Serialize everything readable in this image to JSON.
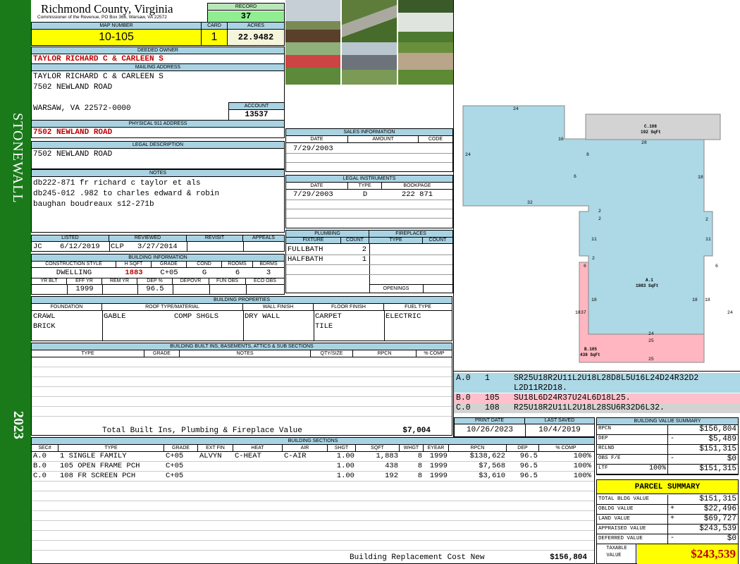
{
  "sidebar": {
    "district": "STONEWALL",
    "year": "2023"
  },
  "header": {
    "county": "Richmond County, Virginia",
    "address_line": "Commissioner of the Revenue, PO Box 366, Warsaw, VA 22572",
    "record_label": "RECORD",
    "record": "37",
    "map_label": "MAP NUMBER",
    "map_number": "10-105",
    "card_label": "CARD",
    "card": "1",
    "acres_label": "ACRES",
    "acres": "22.9482"
  },
  "owner": {
    "deeded_label": "DEEDED OWNER",
    "deeded": "TAYLOR RICHARD C & CARLEEN S",
    "mailing_label": "MAILING ADDRESS",
    "mailing": [
      "TAYLOR RICHARD C & CARLEEN S",
      "7502 NEWLAND ROAD",
      "",
      "WARSAW, VA 22572-0000"
    ],
    "account_label": "ACCOUNT",
    "account": "13537",
    "physical_label": "PHYSICAL 911 ADDRESS",
    "physical": "7502 NEWLAND ROAD",
    "legal_label": "LEGAL DESCRIPTION",
    "legal": "7502 NEWLAND ROAD",
    "notes_label": "NOTES",
    "notes": [
      "db222-871 fr richard c taylor et als",
      "db245-012 .982 to charles edward & robin",
      "baughan boudreaux s12-271b"
    ]
  },
  "sales": {
    "label": "SALES INFORMATION",
    "cols": [
      "DATE",
      "AMOUNT",
      "CODE"
    ],
    "rows": [
      [
        "7/29/2003",
        "",
        ""
      ]
    ]
  },
  "legal_instruments": {
    "label": "LEGAL INSTRUMENTS",
    "cols": [
      "DATE",
      "TYPE",
      "BOOKPAGE"
    ],
    "rows": [
      [
        "7/29/2003",
        "D",
        "222 871"
      ]
    ]
  },
  "listing": {
    "cols": [
      "LISTED",
      "REVIEWED",
      "REVISIT",
      "APPEALS"
    ],
    "listed_by": "JC",
    "listed_date": "6/12/2019",
    "reviewed_by": "CLP",
    "reviewed_date": "3/27/2014",
    "revisit": "",
    "appeals": ""
  },
  "building_info": {
    "label": "BUILDING INFORMATION",
    "cols1": [
      "CONSTRUCTION STYLE",
      "H SQFT",
      "GRADE",
      "COND",
      "ROOMS",
      "BDRMS"
    ],
    "vals1": [
      "DWELLING",
      "1883",
      "C+05",
      "G",
      "6",
      "3"
    ],
    "cols2": [
      "YR BLT",
      "EFF YR",
      "REM YR",
      "DEP %",
      "DEPOVR",
      "FUN OBS",
      "ECO OBS"
    ],
    "vals2": [
      "",
      "1999",
      "",
      "96.5",
      "",
      "",
      ""
    ]
  },
  "plumbing": {
    "label": "PLUMBING",
    "cols": [
      "FIXTURE",
      "COUNT"
    ],
    "rows": [
      [
        "FULLBATH",
        "2"
      ],
      [
        "HALFBATH",
        "1"
      ]
    ]
  },
  "fireplaces": {
    "label": "FIREPLACES",
    "cols": [
      "TYPE",
      "COUNT"
    ],
    "openings_label": "OPENINGS"
  },
  "properties": {
    "label": "BUILDING PROPERTIES",
    "cols": [
      "FOUNDATION",
      "ROOF TYPE/MATERIAL",
      "WALL FINISH",
      "FLOOR FINISH",
      "FUEL TYPE"
    ],
    "foundation": [
      "CRAWL",
      "BRICK"
    ],
    "roof_type": "GABLE",
    "roof_material": "COMP SHGLS",
    "wall": "DRY WALL",
    "floor": [
      "CARPET",
      "TILE"
    ],
    "fuel": "ELECTRIC"
  },
  "builtins": {
    "label": "BUILDING BUILT INS, BASEMENTS, ATTICS & SUB SECTIONS",
    "cols": [
      "TYPE",
      "GRADE",
      "NOTES",
      "QTY/SIZE",
      "RPCN",
      "% COMP"
    ],
    "total_label": "Total Built Ins, Plumbing & Fireplace Value",
    "total_value": "$7,004"
  },
  "sections": {
    "label": "BUILDING SECTIONS",
    "cols": [
      "SEC#",
      "TYPE",
      "GRADE",
      "EXT FIN",
      "HEAT",
      "AIR",
      "SHGT",
      "SQFT",
      "WHGT",
      "EYEAR",
      "RPCN",
      "DEP",
      "% COMP"
    ],
    "rows": [
      [
        "A.0",
        "1 SINGLE FAMILY",
        "C+05",
        "ALVYN",
        "C-HEAT",
        "C-AIR",
        "1.00",
        "1,883",
        "8",
        "1999",
        "$138,622",
        "96.5",
        "100%"
      ],
      [
        "B.0",
        "105 OPEN FRAME PCH",
        "C+05",
        "",
        "",
        "",
        "1.00",
        "438",
        "8",
        "1999",
        "$7,568",
        "96.5",
        "100%"
      ],
      [
        "C.0",
        "108 FR SCREEN PCH",
        "C+05",
        "",
        "",
        "",
        "1.00",
        "192",
        "8",
        "1999",
        "$3,610",
        "96.5",
        "100%"
      ]
    ],
    "brcn_label": "Building Replacement Cost New",
    "brcn_value": "$156,804"
  },
  "sketch": {
    "c_label": "C.108",
    "c_area": "192 SqFt",
    "a_label": "A.1",
    "a_area": "1883 SqFt",
    "b_label": "B.105",
    "b_area": "438 SqFt",
    "dims": [
      "24",
      "16",
      "8",
      "24",
      "6",
      "32",
      "28",
      "18",
      "2",
      "2",
      "11",
      "11",
      "2",
      "2",
      "6",
      "6",
      "18",
      "18",
      "18",
      "18",
      "24",
      "24",
      "25",
      "25",
      "37"
    ],
    "colors": {
      "a": "#add8e6",
      "b": "#ffb6c1",
      "c": "#d3d3d3"
    }
  },
  "vectors": [
    {
      "sec": "A.0",
      "code": "1",
      "vec": "SR25U18R2U11L2U18L28D8L5U16L24D24R32D2",
      "vec2": "L2D11R2D18."
    },
    {
      "sec": "B.0",
      "code": "105",
      "vec": "SU18L6D24R37U24L6D18L25.",
      "vec2": ""
    },
    {
      "sec": "C.0",
      "code": "108",
      "vec": "R25U18R2U11L2U18L28SU6R32D6L32.",
      "vec2": ""
    }
  ],
  "dates": {
    "print_label": "PRINT DATE",
    "print": "10/26/2023",
    "saved_label": "LAST SAVED",
    "saved": "10/4/2019"
  },
  "value_summary": {
    "label": "BUILDING VALUE SUMMARY",
    "rows": [
      {
        "label": "RPCN",
        "pct": "",
        "sign": "",
        "value": "$156,804"
      },
      {
        "label": "DEP",
        "pct": "",
        "sign": "-",
        "value": "$5,489"
      },
      {
        "label": "RCLND",
        "pct": "",
        "sign": "",
        "value": "$151,315"
      },
      {
        "label": "OBS F/E",
        "pct": "",
        "sign": "-",
        "value": "$0"
      },
      {
        "label": "LTF",
        "pct": "100%",
        "sign": "",
        "value": "$151,315"
      }
    ]
  },
  "parcel_summary": {
    "label": "PARCEL SUMMARY",
    "rows": [
      {
        "label": "TOTAL BLDG VALUE",
        "sign": "",
        "value": "$151,315"
      },
      {
        "label": "OBLDG VALUE",
        "sign": "+",
        "value": "$22,496"
      },
      {
        "label": "LAND VALUE",
        "sign": "+",
        "value": "$69,727"
      },
      {
        "label": "APPRAISED VALUE",
        "sign": "",
        "value": "$243,539"
      },
      {
        "label": "DEFERRED VALUE",
        "sign": "-",
        "value": "$0"
      }
    ],
    "taxable_label_1": "TAXABLE",
    "taxable_label_2": "VALUE",
    "taxable": "$243,539"
  }
}
